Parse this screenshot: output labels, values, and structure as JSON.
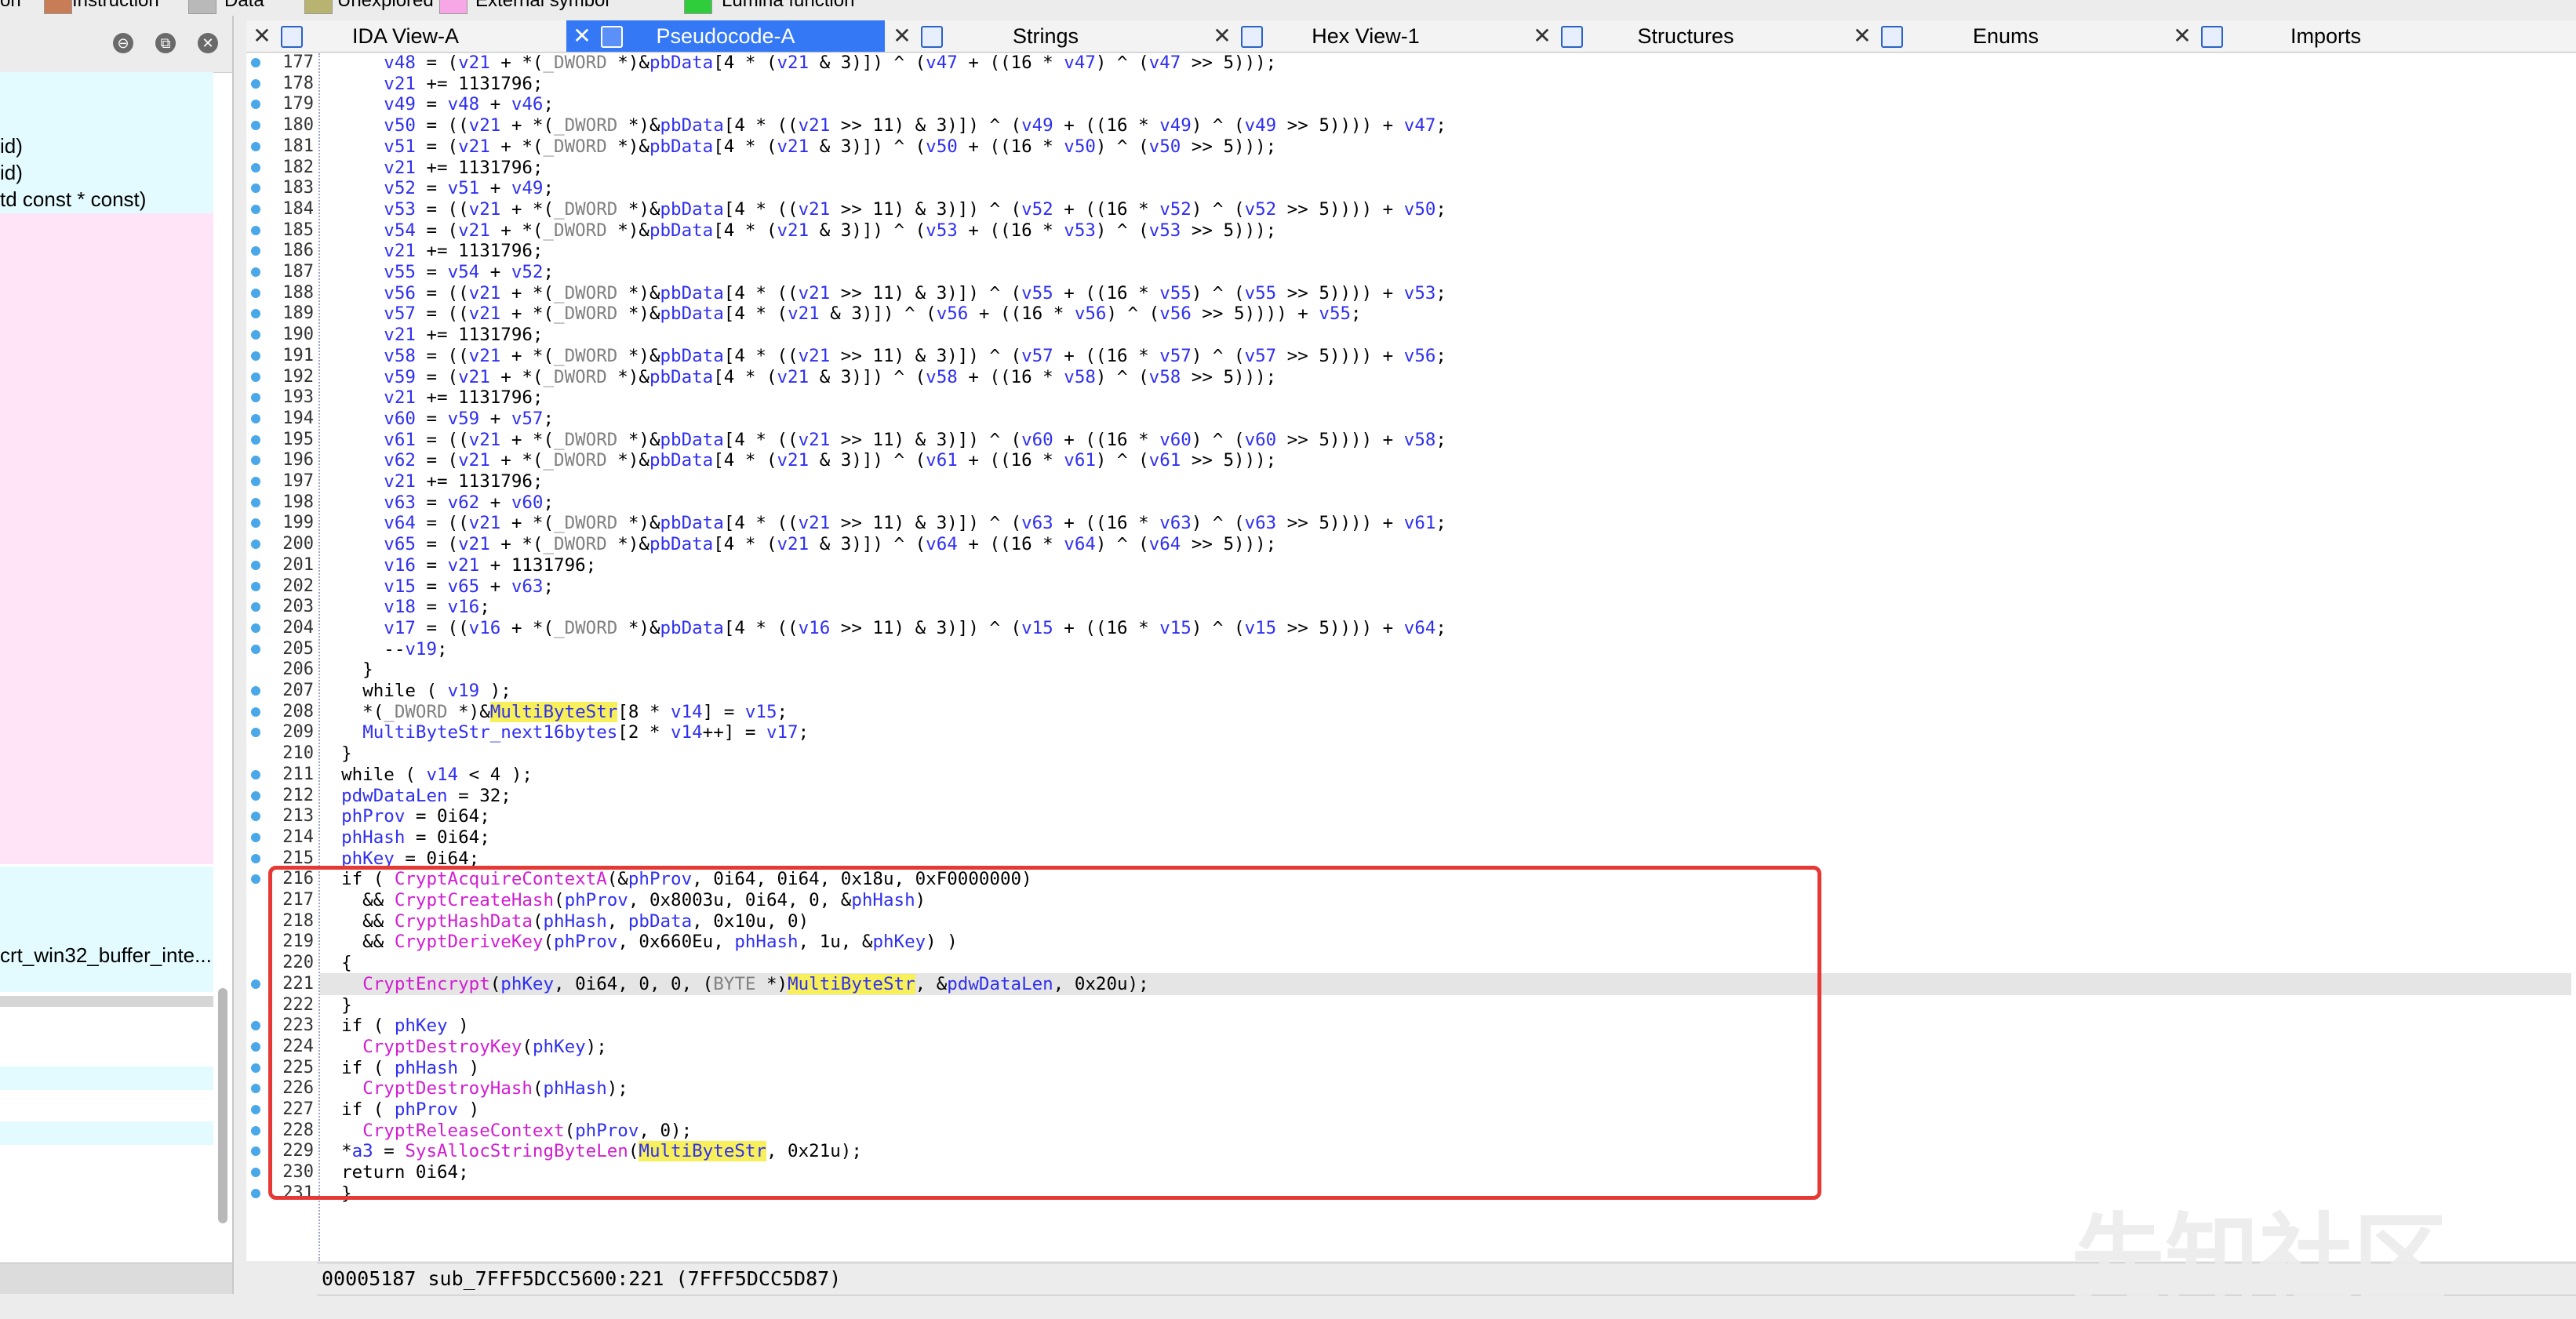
{
  "legend": {
    "items": [
      {
        "label": "on",
        "color": ""
      },
      {
        "label": "Instruction",
        "color": "#c87d56"
      },
      {
        "label": "Data",
        "color": "#b9b9b9"
      },
      {
        "label": "Unexplored",
        "color": "#b9b372"
      },
      {
        "label": "External symbol",
        "color": "#f7a6e6"
      },
      {
        "label": "Lumina function",
        "color": "#2fcc3b"
      }
    ]
  },
  "left_panel": {
    "rows": [
      {
        "text": "id)",
        "bg": "#e3fbff"
      },
      {
        "text": "id)",
        "bg": "#e3fbff"
      },
      {
        "text": "td const * const)",
        "bg": "#e3fbff"
      },
      {
        "text": "crt_win32_buffer_inte...",
        "bg": "#ffffff"
      }
    ]
  },
  "tabs": [
    {
      "label": "IDA View-A",
      "active": false
    },
    {
      "label": "Pseudocode-A",
      "active": true
    },
    {
      "label": "Strings",
      "active": false
    },
    {
      "label": "Hex View-1",
      "active": false
    },
    {
      "label": "Structures",
      "active": false
    },
    {
      "label": "Enums",
      "active": false
    },
    {
      "label": "Imports",
      "active": false
    }
  ],
  "code_lines": [
    {
      "n": "177",
      "dot": true,
      "text": "    v48 = (v21 + *(_DWORD *)&pbData[4 * (v21 & 3)]) ^ (v47 + ((16 * v47) ^ (v47 >> 5)));"
    },
    {
      "n": "178",
      "dot": true,
      "text": "    v21 += 1131796;"
    },
    {
      "n": "179",
      "dot": true,
      "text": "    v49 = v48 + v46;"
    },
    {
      "n": "180",
      "dot": true,
      "text": "    v50 = ((v21 + *(_DWORD *)&pbData[4 * ((v21 >> 11) & 3)]) ^ (v49 + ((16 * v49) ^ (v49 >> 5)))) + v47;"
    },
    {
      "n": "181",
      "dot": true,
      "text": "    v51 = (v21 + *(_DWORD *)&pbData[4 * (v21 & 3)]) ^ (v50 + ((16 * v50) ^ (v50 >> 5)));"
    },
    {
      "n": "182",
      "dot": true,
      "text": "    v21 += 1131796;"
    },
    {
      "n": "183",
      "dot": true,
      "text": "    v52 = v51 + v49;"
    },
    {
      "n": "184",
      "dot": true,
      "text": "    v53 = ((v21 + *(_DWORD *)&pbData[4 * ((v21 >> 11) & 3)]) ^ (v52 + ((16 * v52) ^ (v52 >> 5)))) + v50;"
    },
    {
      "n": "185",
      "dot": true,
      "text": "    v54 = (v21 + *(_DWORD *)&pbData[4 * (v21 & 3)]) ^ (v53 + ((16 * v53) ^ (v53 >> 5)));"
    },
    {
      "n": "186",
      "dot": true,
      "text": "    v21 += 1131796;"
    },
    {
      "n": "187",
      "dot": true,
      "text": "    v55 = v54 + v52;"
    },
    {
      "n": "188",
      "dot": true,
      "text": "    v56 = ((v21 + *(_DWORD *)&pbData[4 * ((v21 >> 11) & 3)]) ^ (v55 + ((16 * v55) ^ (v55 >> 5)))) + v53;"
    },
    {
      "n": "189",
      "dot": true,
      "text": "    v57 = ((v21 + *(_DWORD *)&pbData[4 * (v21 & 3)]) ^ (v56 + ((16 * v56) ^ (v56 >> 5)))) + v55;"
    },
    {
      "n": "190",
      "dot": true,
      "text": "    v21 += 1131796;"
    },
    {
      "n": "191",
      "dot": true,
      "text": "    v58 = ((v21 + *(_DWORD *)&pbData[4 * ((v21 >> 11) & 3)]) ^ (v57 + ((16 * v57) ^ (v57 >> 5)))) + v56;"
    },
    {
      "n": "192",
      "dot": true,
      "text": "    v59 = (v21 + *(_DWORD *)&pbData[4 * (v21 & 3)]) ^ (v58 + ((16 * v58) ^ (v58 >> 5)));"
    },
    {
      "n": "193",
      "dot": true,
      "text": "    v21 += 1131796;"
    },
    {
      "n": "194",
      "dot": true,
      "text": "    v60 = v59 + v57;"
    },
    {
      "n": "195",
      "dot": true,
      "text": "    v61 = ((v21 + *(_DWORD *)&pbData[4 * ((v21 >> 11) & 3)]) ^ (v60 + ((16 * v60) ^ (v60 >> 5)))) + v58;"
    },
    {
      "n": "196",
      "dot": true,
      "text": "    v62 = (v21 + *(_DWORD *)&pbData[4 * (v21 & 3)]) ^ (v61 + ((16 * v61) ^ (v61 >> 5)));"
    },
    {
      "n": "197",
      "dot": true,
      "text": "    v21 += 1131796;"
    },
    {
      "n": "198",
      "dot": true,
      "text": "    v63 = v62 + v60;"
    },
    {
      "n": "199",
      "dot": true,
      "text": "    v64 = ((v21 + *(_DWORD *)&pbData[4 * ((v21 >> 11) & 3)]) ^ (v63 + ((16 * v63) ^ (v63 >> 5)))) + v61;"
    },
    {
      "n": "200",
      "dot": true,
      "text": "    v65 = (v21 + *(_DWORD *)&pbData[4 * (v21 & 3)]) ^ (v64 + ((16 * v64) ^ (v64 >> 5)));"
    },
    {
      "n": "201",
      "dot": true,
      "text": "    v16 = v21 + 1131796;"
    },
    {
      "n": "202",
      "dot": true,
      "text": "    v15 = v65 + v63;"
    },
    {
      "n": "203",
      "dot": true,
      "text": "    v18 = v16;"
    },
    {
      "n": "204",
      "dot": true,
      "text": "    v17 = ((v16 + *(_DWORD *)&pbData[4 * ((v16 >> 11) & 3)]) ^ (v15 + ((16 * v15) ^ (v15 >> 5)))) + v64;"
    },
    {
      "n": "205",
      "dot": true,
      "text": "    --v19;"
    },
    {
      "n": "206",
      "dot": false,
      "text": "  }"
    },
    {
      "n": "207",
      "dot": true,
      "text": "  while ( v19 );"
    },
    {
      "n": "208",
      "dot": true,
      "text": "  *(_DWORD *)&MultiByteStr[8 * v14] = v15;"
    },
    {
      "n": "209",
      "dot": true,
      "text": "  MultiByteStr_next16bytes[2 * v14++] = v17;"
    },
    {
      "n": "210",
      "dot": false,
      "text": "}"
    },
    {
      "n": "211",
      "dot": true,
      "text": "while ( v14 < 4 );"
    },
    {
      "n": "212",
      "dot": true,
      "text": "pdwDataLen = 32;"
    },
    {
      "n": "213",
      "dot": true,
      "text": "phProv = 0i64;"
    },
    {
      "n": "214",
      "dot": true,
      "text": "phHash = 0i64;"
    },
    {
      "n": "215",
      "dot": true,
      "text": "phKey = 0i64;"
    },
    {
      "n": "216",
      "dot": true,
      "text": "if ( CryptAcquireContextA(&phProv, 0i64, 0i64, 0x18u, 0xF0000000)"
    },
    {
      "n": "217",
      "dot": false,
      "text": "  && CryptCreateHash(phProv, 0x8003u, 0i64, 0, &phHash)"
    },
    {
      "n": "218",
      "dot": false,
      "text": "  && CryptHashData(phHash, pbData, 0x10u, 0)"
    },
    {
      "n": "219",
      "dot": false,
      "text": "  && CryptDeriveKey(phProv, 0x660Eu, phHash, 1u, &phKey) )"
    },
    {
      "n": "220",
      "dot": false,
      "text": "{"
    },
    {
      "n": "221",
      "dot": true,
      "text": "  CryptEncrypt(phKey, 0i64, 0, 0, (BYTE *)MultiByteStr, &pdwDataLen, 0x20u);"
    },
    {
      "n": "222",
      "dot": false,
      "text": "}"
    },
    {
      "n": "223",
      "dot": true,
      "text": "if ( phKey )"
    },
    {
      "n": "224",
      "dot": true,
      "text": "  CryptDestroyKey(phKey);"
    },
    {
      "n": "225",
      "dot": true,
      "text": "if ( phHash )"
    },
    {
      "n": "226",
      "dot": true,
      "text": "  CryptDestroyHash(phHash);"
    },
    {
      "n": "227",
      "dot": true,
      "text": "if ( phProv )"
    },
    {
      "n": "228",
      "dot": true,
      "text": "  CryptReleaseContext(phProv, 0);"
    },
    {
      "n": "229",
      "dot": true,
      "text": "*a3 = SysAllocStringByteLen(MultiByteStr, 0x21u);"
    },
    {
      "n": "230",
      "dot": true,
      "text": "return 0i64;"
    },
    {
      "n": "231",
      "dot": true,
      "text": "}"
    }
  ],
  "current_line": "221",
  "status_bar": "00005187 sub_7FFF5DCC5600:221 (7FFF5DCC5D87)",
  "watermark": "先知社区",
  "colors": {
    "variable": "#2f2ff0",
    "function": "#d11dd1",
    "highlight": "#f7f05a",
    "annotation_box": "#e53935",
    "active_tab": "#3478f6"
  }
}
